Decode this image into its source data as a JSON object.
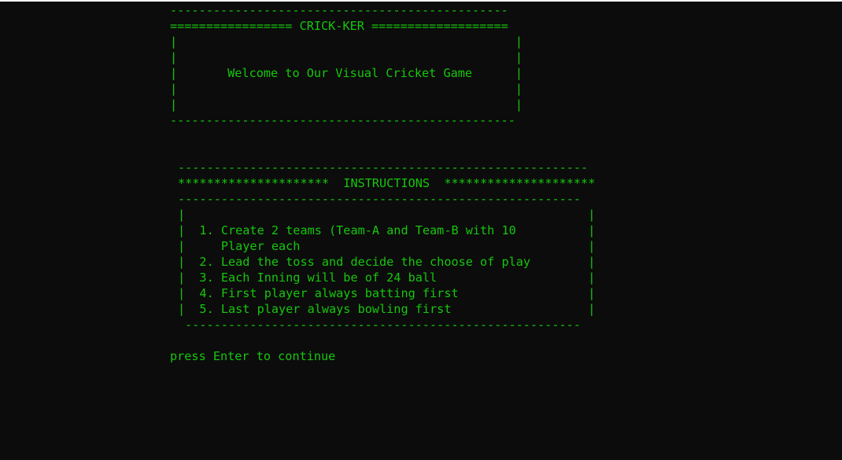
{
  "app": {
    "title": "CRICK-KER",
    "accent_color": "#16c60c",
    "background_color": "#0c0c0c"
  },
  "banner": {
    "top_rule": "-----------------------------------------------",
    "title_line": "================= CRICK-KER ===================",
    "side_line": "|                                               |",
    "welcome_line": "|       Welcome to Our Visual Cricket Game      |",
    "bottom_rule": "------------------------------------------------"
  },
  "instructions": {
    "top_rule": "---------------------------------------------------------",
    "title_line": "*********************  INSTRUCTIONS  *********************",
    "under_rule": "--------------------------------------------------------",
    "blank_row": "|                                                        |",
    "rows": [
      "|  1. Create 2 teams (Team-A and Team-B with 10          |",
      "|     Player each                                        |",
      "|  2. Lead the toss and decide the choose of play        |",
      "|  3. Each Inning will be of 24 ball                     |",
      "|  4. First player always batting first                  |",
      "|  5. Last player always bowling first                   |"
    ],
    "bottom_rule": "-------------------------------------------------------"
  },
  "prompt": {
    "text": "press Enter to continue"
  }
}
